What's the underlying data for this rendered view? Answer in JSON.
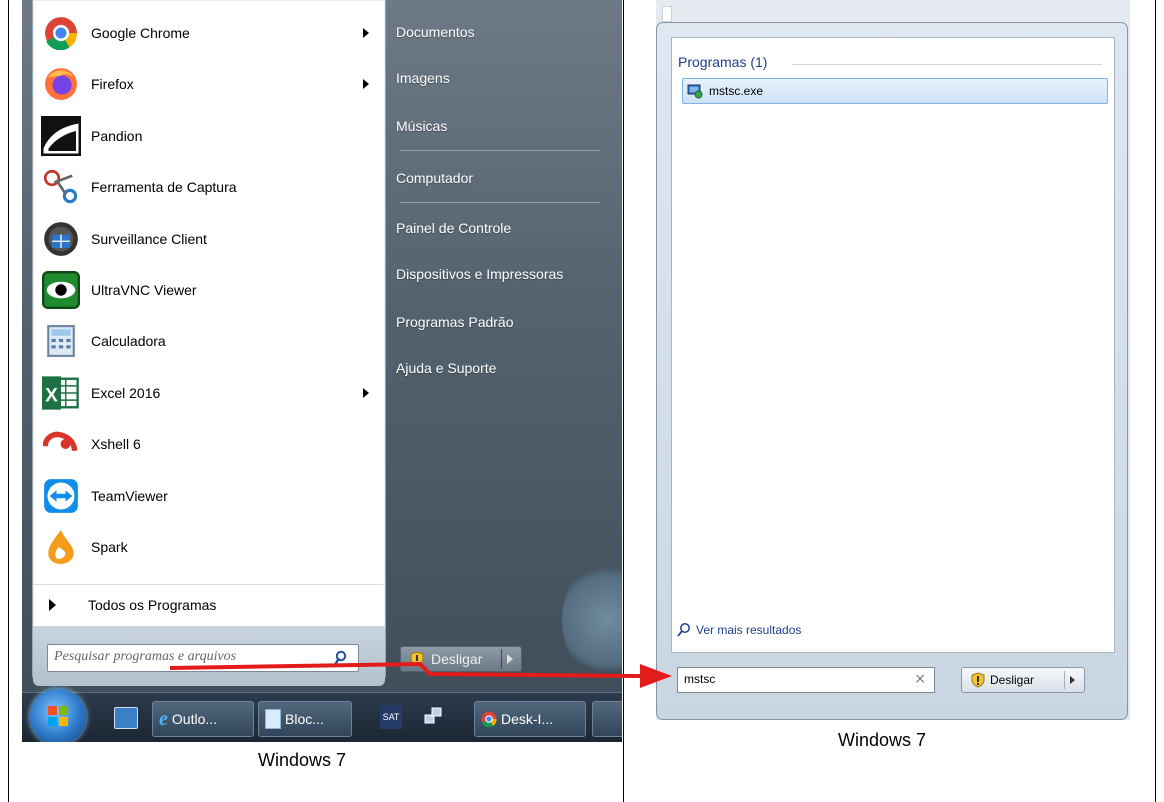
{
  "left_menu": {
    "programs": [
      {
        "label": "Google Chrome",
        "has_submenu": true,
        "icon": "chrome-icon"
      },
      {
        "label": "Firefox",
        "has_submenu": true,
        "icon": "firefox-icon"
      },
      {
        "label": "Pandion",
        "has_submenu": false,
        "icon": "pandion-icon"
      },
      {
        "label": "Ferramenta de Captura",
        "has_submenu": false,
        "icon": "scissors-icon"
      },
      {
        "label": "Surveillance Client",
        "has_submenu": false,
        "icon": "surveillance-icon"
      },
      {
        "label": "UltraVNC Viewer",
        "has_submenu": false,
        "icon": "eye-icon"
      },
      {
        "label": "Calculadora",
        "has_submenu": false,
        "icon": "calculator-icon"
      },
      {
        "label": "Excel 2016",
        "has_submenu": true,
        "icon": "excel-icon"
      },
      {
        "label": "Xshell 6",
        "has_submenu": false,
        "icon": "xshell-icon"
      },
      {
        "label": "TeamViewer",
        "has_submenu": false,
        "icon": "teamviewer-icon"
      },
      {
        "label": "Spark",
        "has_submenu": false,
        "icon": "spark-icon"
      }
    ],
    "all_programs": "Todos os Programas",
    "search_placeholder": "Pesquisar programas e arquivos",
    "right_column": [
      "Documentos",
      "Imagens",
      "Músicas",
      "Computador",
      "Painel de Controle",
      "Dispositivos e Impressoras",
      "Programas Padrão",
      "Ajuda e Suporte"
    ],
    "shutdown_label": "Desligar",
    "taskbar": {
      "items": [
        "Outlo...",
        "Bloc...",
        "Desk-I..."
      ],
      "sat_label": "SAT"
    },
    "caption": "Windows 7"
  },
  "right_panel": {
    "section_title": "Programas (1)",
    "result": "mstsc.exe",
    "more_results": "Ver mais resultados",
    "search_value": "mstsc",
    "clear_symbol": "×",
    "shutdown_label": "Desligar",
    "caption": "Windows 7"
  },
  "colors": {
    "annotation_arrow": "#e21b1b",
    "link_blue": "#1e3f8a",
    "selection": "#cfe3f8"
  }
}
